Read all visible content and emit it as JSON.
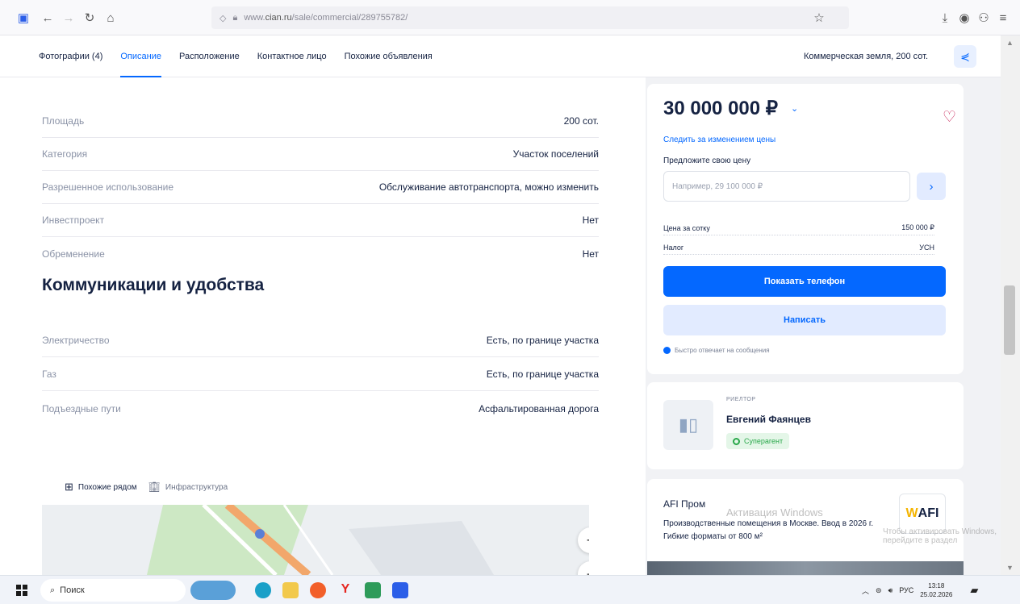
{
  "browser": {
    "url_prefix": "www.",
    "url_domain": "cian.ru",
    "url_path": "/sale/commercial/289755782/"
  },
  "page_nav": {
    "tabs": [
      "Фотографии (4)",
      "Описание",
      "Расположение",
      "Контактное лицо",
      "Похожие объявления"
    ],
    "active_tab": "Описание",
    "right_title": "Коммерческая земля, 200 сот."
  },
  "params": [
    {
      "key": "Площадь",
      "value": "200 сот."
    },
    {
      "key": "Категория",
      "value": "Участок поселений"
    },
    {
      "key": "Разрешенное использование",
      "value": "Обслуживание автотранспорта, можно изменить"
    },
    {
      "key": "Инвестпроект",
      "value": "Нет"
    },
    {
      "key": "Обременение",
      "value": "Нет"
    }
  ],
  "communications": {
    "title": "Коммуникации и удобства",
    "items": [
      {
        "key": "Электричество",
        "value": "Есть, по границе участка"
      },
      {
        "key": "Газ",
        "value": "Есть, по границе участка"
      },
      {
        "key": "Подъездные пути",
        "value": "Асфальтированная дорога"
      }
    ]
  },
  "map": {
    "tab_nearby": "Похожие рядом",
    "tab_infra": "Инфраструктура",
    "zoom_in": "+",
    "zoom_out": "−"
  },
  "price_card": {
    "price": "30 000 000 ₽",
    "follow_link": "Следить за изменением цены",
    "offer_label": "Предложите свою цену",
    "offer_placeholder": "Например, 29 100 000 ₽",
    "price_per_sotka_label": "Цена за сотку",
    "price_per_sotka_value": "150 000 ₽",
    "tax_label": "Налог",
    "tax_value": "УСН",
    "show_phone": "Показать телефон",
    "write": "Написать",
    "reply_note": "Быстро отвечает на сообщения"
  },
  "agent": {
    "role": "РИЕЛТОР",
    "name": "Евгений Фаянцев",
    "badge": "Суперагент"
  },
  "ad": {
    "title": "AFI Пром",
    "text": "Производственные помещения в Москве. Ввод в 2026 г. Гибкие форматы от 800 м²",
    "logo_w": "W",
    "logo_text": "AFI"
  },
  "watermark": {
    "line1": "Активация Windows",
    "line2": "Чтобы активировать Windows, перейдите в раздел"
  },
  "taskbar": {
    "search": "Поиск",
    "lang": "РУС",
    "time": "13:18",
    "date": "25.02.2026"
  }
}
